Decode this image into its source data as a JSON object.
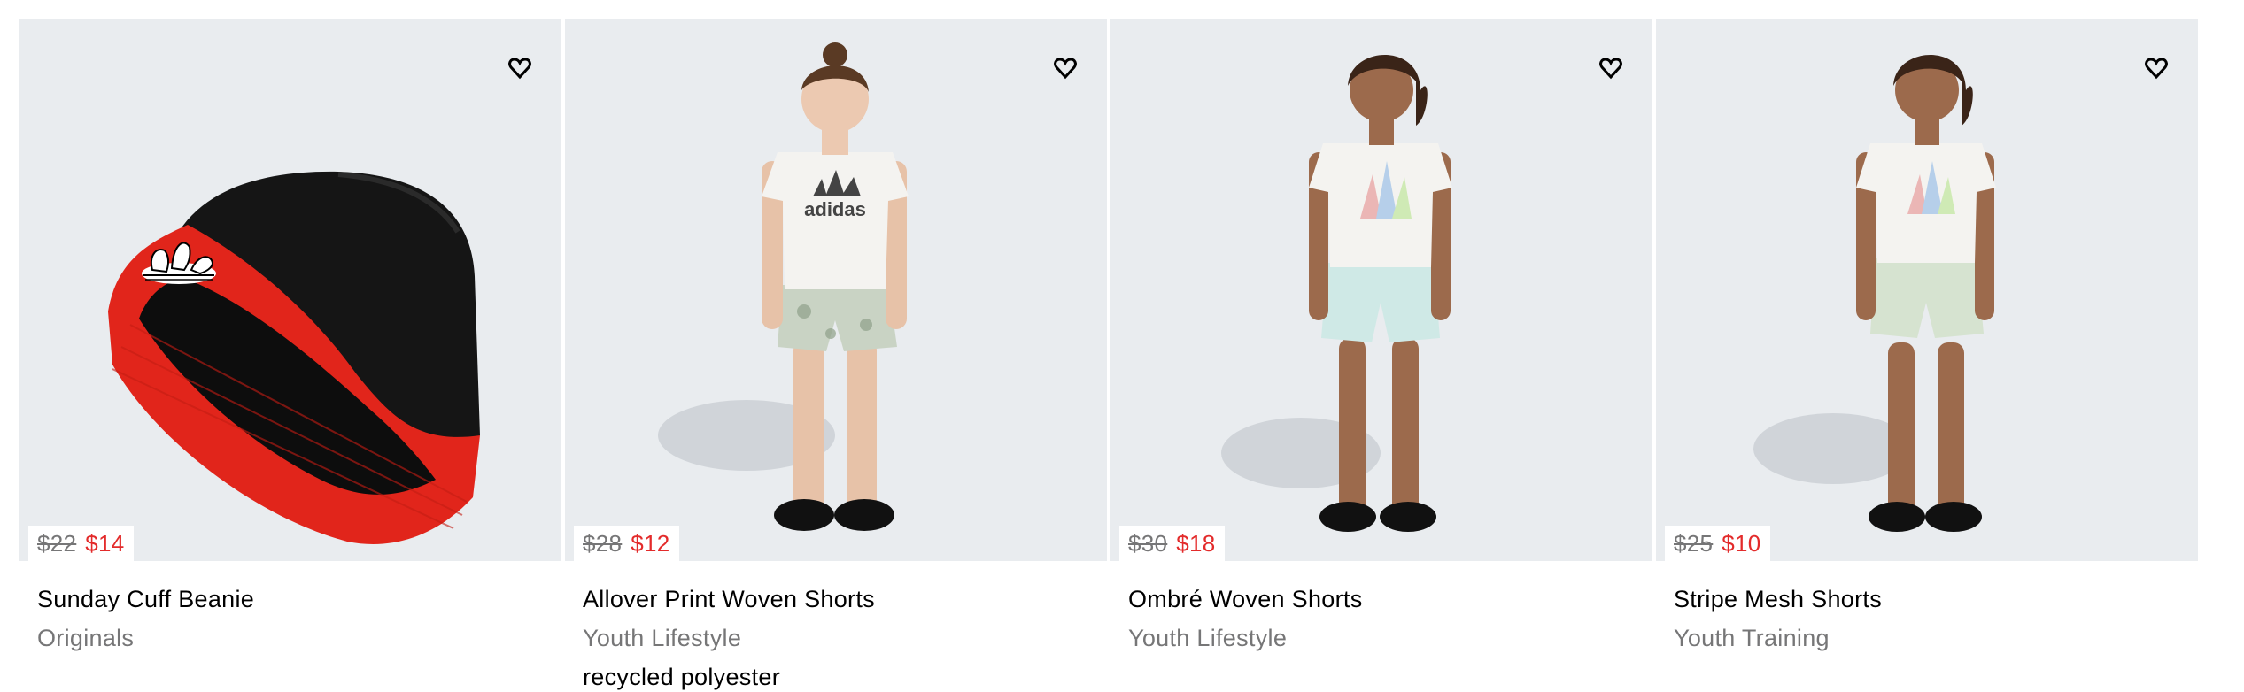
{
  "products": [
    {
      "name": "Sunday Cuff Beanie",
      "category": "Originals",
      "price_original": "$22",
      "price_sale": "$14",
      "wishlist_icon": "heart-icon",
      "image_kind": "beanie"
    },
    {
      "name": "Allover Print Woven Shorts",
      "category": "Youth Lifestyle",
      "extra": "recycled polyester",
      "price_original": "$28",
      "price_sale": "$12",
      "wishlist_icon": "heart-icon",
      "image_kind": "model-printed-shorts"
    },
    {
      "name": "Ombré Woven Shorts",
      "category": "Youth Lifestyle",
      "price_original": "$30",
      "price_sale": "$18",
      "wishlist_icon": "heart-icon",
      "image_kind": "model-ombre-shorts"
    },
    {
      "name": "Stripe Mesh Shorts",
      "category": "Youth Training",
      "price_original": "$25",
      "price_sale": "$10",
      "wishlist_icon": "heart-icon",
      "image_kind": "model-mesh-shorts"
    }
  ],
  "colors": {
    "image_background": "#e9ecef",
    "sale_price": "#e32b2b",
    "muted_text": "#767677"
  }
}
